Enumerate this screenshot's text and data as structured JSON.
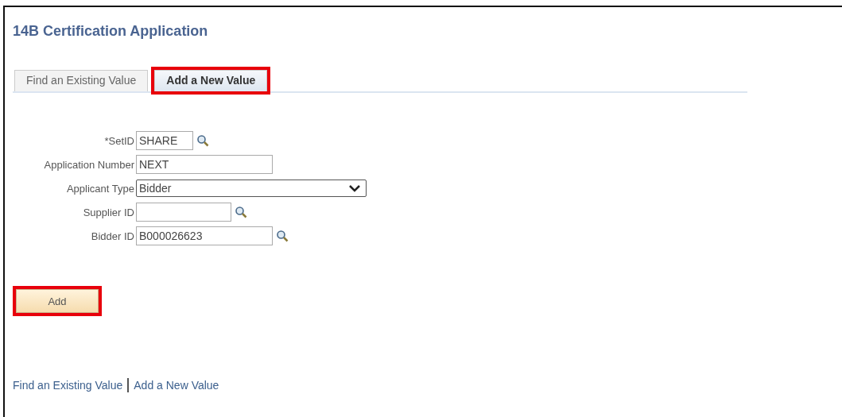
{
  "page": {
    "title": "14B Certification Application"
  },
  "tabs": [
    {
      "label": "Find an Existing Value",
      "selected": false,
      "highlighted": false
    },
    {
      "label": "Add a New Value",
      "selected": true,
      "highlighted": true
    }
  ],
  "fields": [
    {
      "label": "*SetID",
      "kind": "text",
      "value": "SHARE",
      "lookup": true
    },
    {
      "label": "Application Number",
      "kind": "text",
      "value": "NEXT",
      "lookup": false
    },
    {
      "label": "Applicant Type",
      "kind": "select",
      "value": "Bidder",
      "lookup": false
    },
    {
      "label": "Supplier ID",
      "kind": "text",
      "lookup": true
    },
    {
      "label": "Bidder ID",
      "kind": "text",
      "value": "B000026623",
      "lookup": true
    }
  ],
  "add_button": {
    "label": "Add",
    "highlighted": true
  },
  "footer_links": [
    "Find an Existing Value",
    "Add a New Value"
  ]
}
